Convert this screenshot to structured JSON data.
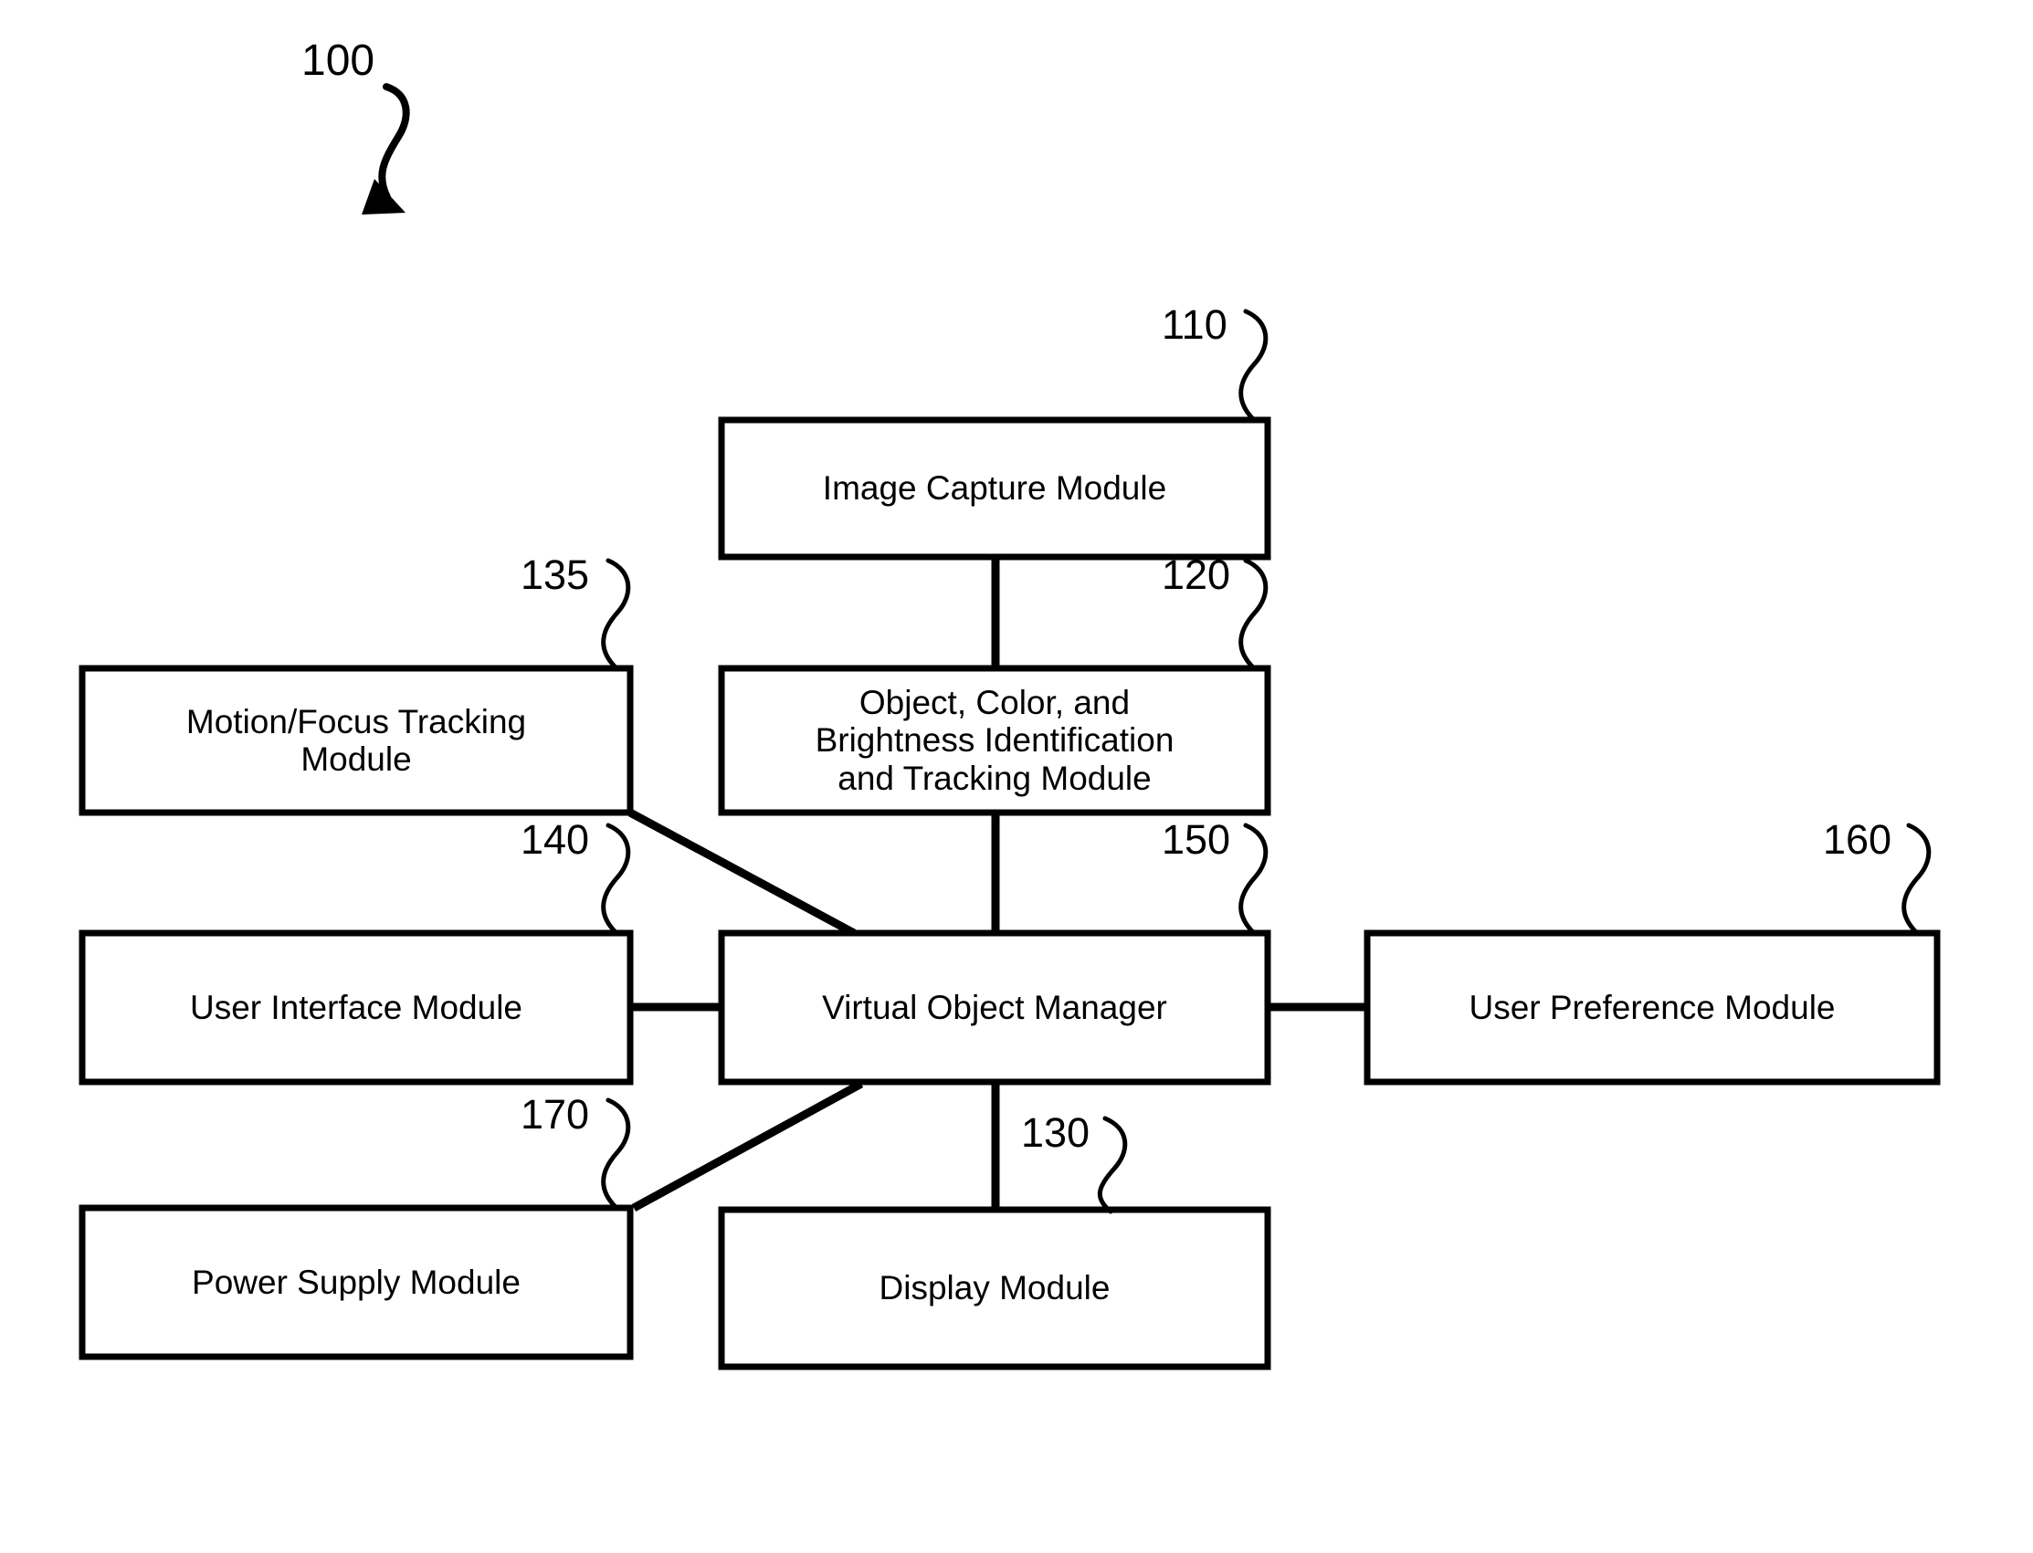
{
  "figure": {
    "number": "100",
    "type": "patent-block-diagram"
  },
  "style": {
    "line_color": "#000000",
    "box_fill": "#ffffff",
    "background": "#ffffff"
  },
  "blocks": [
    {
      "ref": "110",
      "label": "Image Capture Module",
      "name": "image-capture-module"
    },
    {
      "ref": "120",
      "label": "Object, Color, and\nBrightness Identification\nand Tracking Module",
      "name": "object-color-brightness-module"
    },
    {
      "ref": "135",
      "label": "Motion/Focus Tracking\nModule",
      "name": "motion-focus-tracking-module"
    },
    {
      "ref": "150",
      "label": "Virtual Object Manager",
      "name": "virtual-object-manager"
    },
    {
      "ref": "140",
      "label": "User Interface Module",
      "name": "user-interface-module"
    },
    {
      "ref": "160",
      "label": "User Preference Module",
      "name": "user-preference-module"
    },
    {
      "ref": "170",
      "label": "Power Supply Module",
      "name": "power-supply-module"
    },
    {
      "ref": "130",
      "label": "Display Module",
      "name": "display-module"
    }
  ],
  "connections": [
    {
      "from": "110",
      "to": "120",
      "kind": "vertical"
    },
    {
      "from": "120",
      "to": "150",
      "kind": "vertical"
    },
    {
      "from": "135",
      "to": "150",
      "kind": "diagonal"
    },
    {
      "from": "140",
      "to": "150",
      "kind": "horizontal"
    },
    {
      "from": "150",
      "to": "160",
      "kind": "horizontal"
    },
    {
      "from": "150",
      "to": "170",
      "kind": "diagonal"
    },
    {
      "from": "150",
      "to": "130",
      "kind": "vertical"
    }
  ]
}
